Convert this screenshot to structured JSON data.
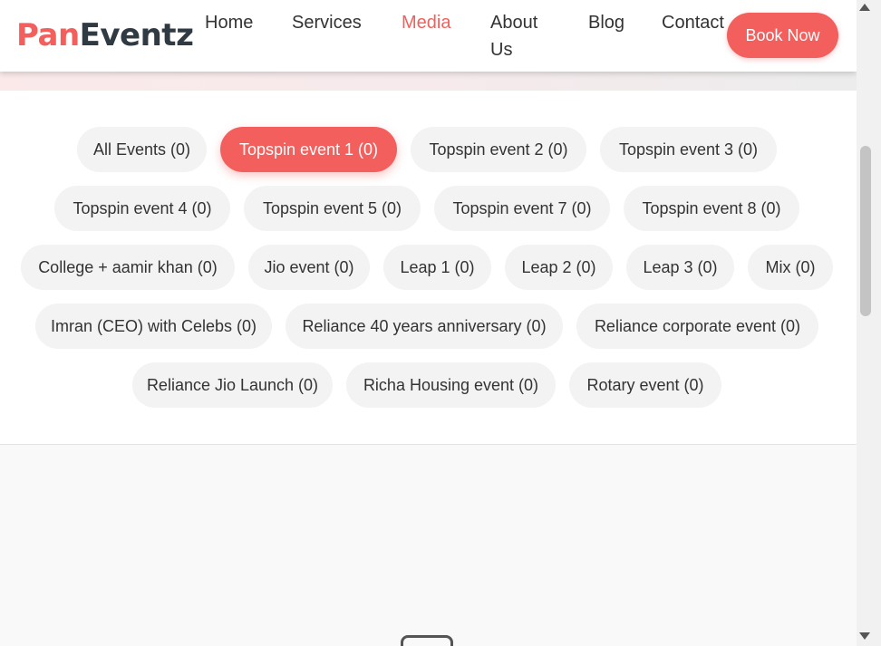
{
  "brand": {
    "part1": "Pan",
    "part2": "Eventz"
  },
  "nav": {
    "home": "Home",
    "services": "Services",
    "media": "Media",
    "about_line1": "About",
    "about_line2": "Us",
    "blog": "Blog",
    "contact": "Contact",
    "active": "Media"
  },
  "header": {
    "book_label": "Book Now"
  },
  "filters": [
    "All Events (0)",
    "Topspin event 1 (0)",
    "Topspin event 2 (0)",
    "Topspin event 3 (0)",
    "Topspin event 4 (0)",
    "Topspin event 5 (0)",
    "Topspin event 7 (0)",
    "Topspin event 8 (0)",
    "College + aamir khan (0)",
    "Jio event (0)",
    "Leap 1 (0)",
    "Leap 2 (0)",
    "Leap 3 (0)",
    "Mix (0)",
    "Imran (CEO) with Celebs (0)",
    "Reliance 40 years anniversary (0)",
    "Reliance corporate event (0)",
    "Reliance Jio Launch (0)",
    "Richa Housing event (0)",
    "Rotary event (0)"
  ],
  "active_filter": "Topspin event 1 (0)",
  "colors": {
    "accent": "#f25f5c",
    "dark": "#2f3a42",
    "pill_bg": "#f3f3f3"
  }
}
